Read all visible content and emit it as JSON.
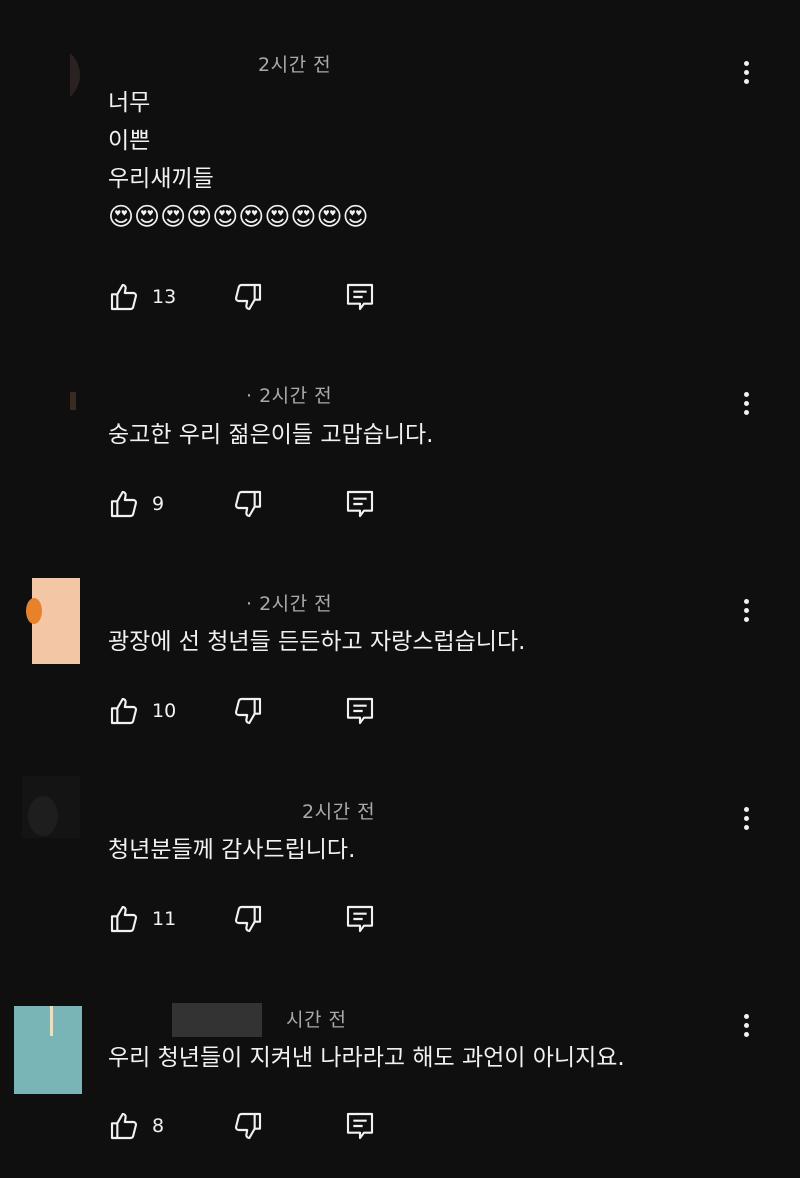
{
  "colors": {
    "background": "#0f0f0f",
    "text": "#f1f1f1",
    "meta_text": "#aaaaaa"
  },
  "comments": [
    {
      "time": "2시간 전",
      "lines": [
        "너무",
        "이쁜",
        "우리새끼들"
      ],
      "emoji": "😍😍😍😍😍😍😍😍😍😍",
      "likes": "13"
    },
    {
      "time": "· 2시간 전",
      "lines": [
        "숭고한 우리 젊은이들 고맙습니다."
      ],
      "likes": "9"
    },
    {
      "time": "· 2시간 전",
      "lines": [
        "광장에 선 청년들 든든하고 자랑스럽습니다."
      ],
      "likes": "10"
    },
    {
      "time": "2시간 전",
      "lines": [
        "청년분들께 감사드립니다."
      ],
      "likes": "11"
    },
    {
      "time": "시간 전",
      "lines": [
        "우리 청년들이 지켜낸 나라라고 해도 과언이 아니지요."
      ],
      "likes": "8"
    }
  ],
  "icons": {
    "like": "thumbs-up-icon",
    "dislike": "thumbs-down-icon",
    "reply": "reply-icon",
    "more": "more-vertical-icon"
  }
}
